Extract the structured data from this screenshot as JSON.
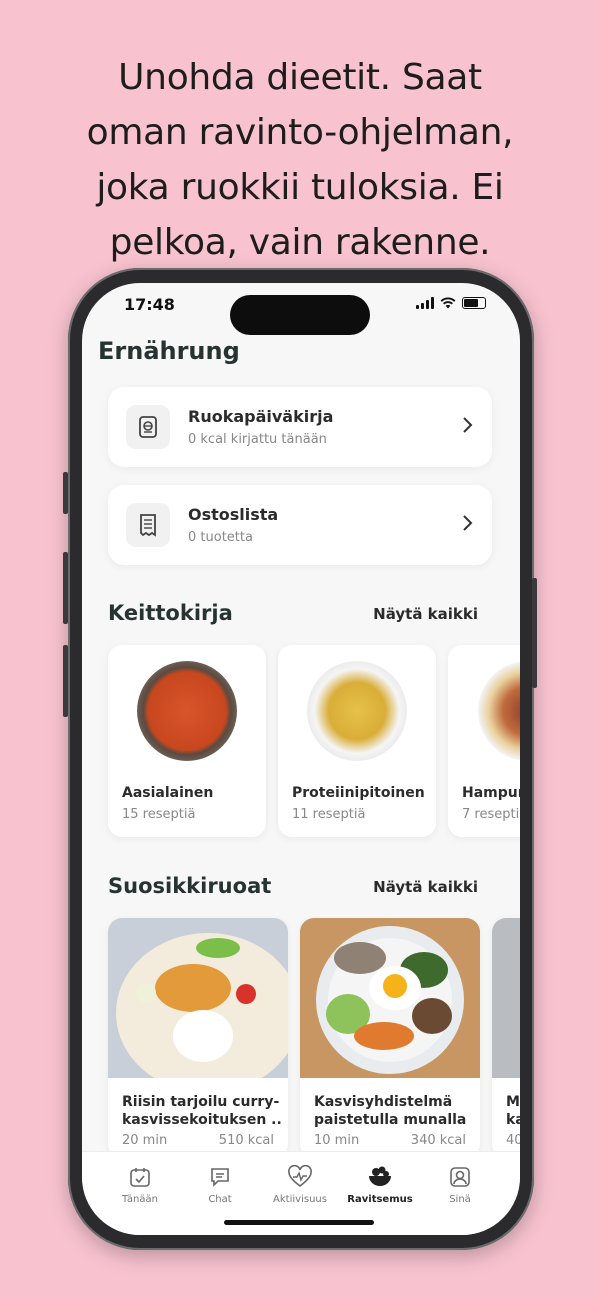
{
  "headline": [
    "Unohda dieetit. Saat",
    "oman ravinto-ohjelman,",
    "joka ruokkii tuloksia. Ei",
    "pelkoa, vain rakenne."
  ],
  "status": {
    "time": "17:48"
  },
  "page_title": "Ernährung",
  "cards": [
    {
      "title": "Ruokapäiväkirja",
      "subtitle": "0 kcal kirjattu tänään",
      "icon": "journal-icon"
    },
    {
      "title": "Ostoslista",
      "subtitle": "0 tuotetta",
      "icon": "shopping-list-icon"
    }
  ],
  "cookbook": {
    "title": "Keittokirja",
    "link": "Näytä kaikki",
    "items": [
      {
        "name": "Aasialainen",
        "count": "15 reseptiä"
      },
      {
        "name": "Proteiinipitoinen",
        "count": "11 reseptiä"
      },
      {
        "name": "Hampuri",
        "count": "7 resepti"
      }
    ]
  },
  "favorites": {
    "title": "Suosikkiruoat",
    "link": "Näytä kaikki",
    "items": [
      {
        "line1": "Riisin tarjoilu curry-",
        "line2": "kasvissekoituksen ...",
        "time": "20 min",
        "kcal": "510 kcal"
      },
      {
        "line1": "Kasvisyhdistelmä",
        "line2": "paistetulla munalla",
        "time": "10 min",
        "kcal": "340 kcal"
      },
      {
        "line1": "M",
        "line2": "ka",
        "time": "40",
        "kcal": ""
      }
    ]
  },
  "tabs": [
    {
      "label": "Tänään",
      "icon": "calendar-check-icon"
    },
    {
      "label": "Chat",
      "icon": "chat-icon"
    },
    {
      "label": "Aktiivisuus",
      "icon": "heart-pulse-icon"
    },
    {
      "label": "Ravitsemus",
      "icon": "food-bowl-icon",
      "active": true
    },
    {
      "label": "Sinä",
      "icon": "profile-icon"
    }
  ],
  "colors": {
    "background": "#f8c3cf",
    "screen": "#f7f7f7",
    "text": "#263330"
  }
}
